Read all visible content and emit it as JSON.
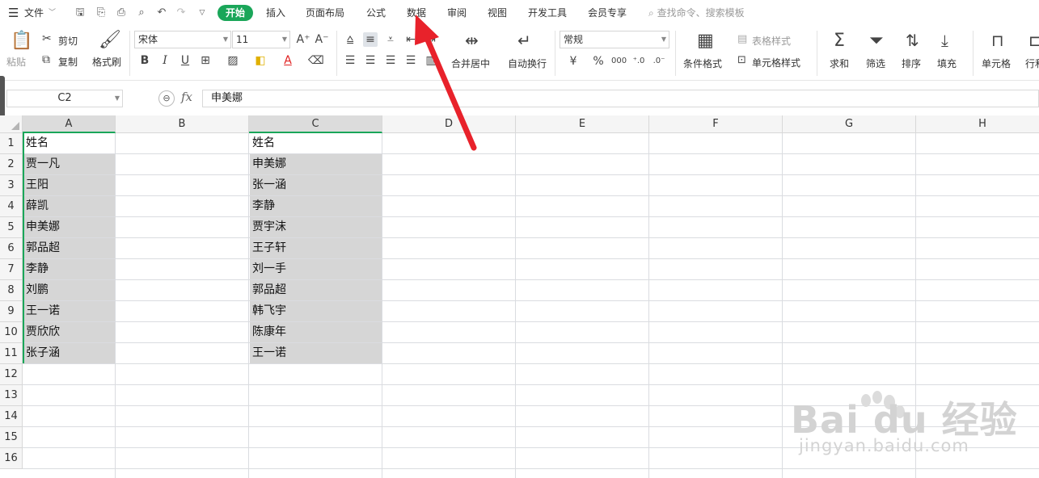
{
  "menubar": {
    "file_menu": "文件",
    "tabs": [
      "开始",
      "插入",
      "页面布局",
      "公式",
      "数据",
      "审阅",
      "视图",
      "开发工具",
      "会员专享"
    ],
    "search_placeholder": "查找命令、搜索模板"
  },
  "ribbon": {
    "paste": "粘贴",
    "cut": "剪切",
    "copy": "复制",
    "format_painter": "格式刷",
    "font_name": "宋体",
    "font_size": "11",
    "merge_center": "合并居中",
    "wrap_text": "自动换行",
    "number_format": "常规",
    "conditional_format": "条件格式",
    "table_style": "表格样式",
    "cell_style": "单元格样式",
    "sum": "求和",
    "filter": "筛选",
    "sort": "排序",
    "fill": "填充",
    "cell": "单元格",
    "row_col": "行和",
    "percent": "%",
    "currency": "¥",
    "thousands": "000"
  },
  "formula_bar": {
    "name_box": "C2",
    "fx": "fx",
    "content": "申美娜"
  },
  "sheet": {
    "columns": [
      "A",
      "B",
      "C",
      "D",
      "E",
      "F",
      "G",
      "H"
    ],
    "rows": [
      "1",
      "2",
      "3",
      "4",
      "5",
      "6",
      "7",
      "8",
      "9",
      "10",
      "11",
      "12",
      "13",
      "14",
      "15",
      "16"
    ],
    "col_a": [
      "姓名",
      "贾一凡",
      "王阳",
      "薛凯",
      "申美娜",
      "郭品超",
      "李静",
      "刘鹏",
      "王一诺",
      "贾欣欣",
      "张子涵"
    ],
    "col_c": [
      "姓名",
      "申美娜",
      "张一涵",
      "李静",
      "贾宇沫",
      "王子轩",
      "刘一手",
      "郭品超",
      "韩飞宇",
      "陈康年",
      "王一诺"
    ]
  },
  "watermark": {
    "logo": "Bai du 经验",
    "url": "jingyan.baidu.com"
  },
  "colors": {
    "accent": "#1aa659",
    "arrow": "#e8222b",
    "highlight": "#d6d6d6"
  }
}
